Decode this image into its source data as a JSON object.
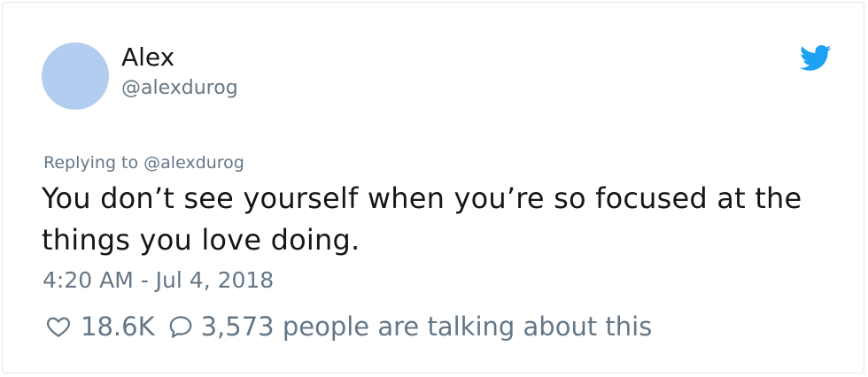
{
  "tweet": {
    "display_name": "Alex",
    "handle": "@alexdurog",
    "replying_label": "Replying to @alexdurog",
    "text": "You don’t see yourself when you’re so focused at the things you love doing.",
    "timestamp": "4:20 AM - Jul 4, 2018",
    "likes": "18.6K",
    "conversation_text": "3,573 people are talking about this",
    "avatar_color": "#b3cdf0",
    "brand_color": "#1da1f2",
    "icons": {
      "brand": "twitter-bird-icon",
      "like": "heart-icon",
      "reply": "speech-bubble-icon"
    }
  }
}
